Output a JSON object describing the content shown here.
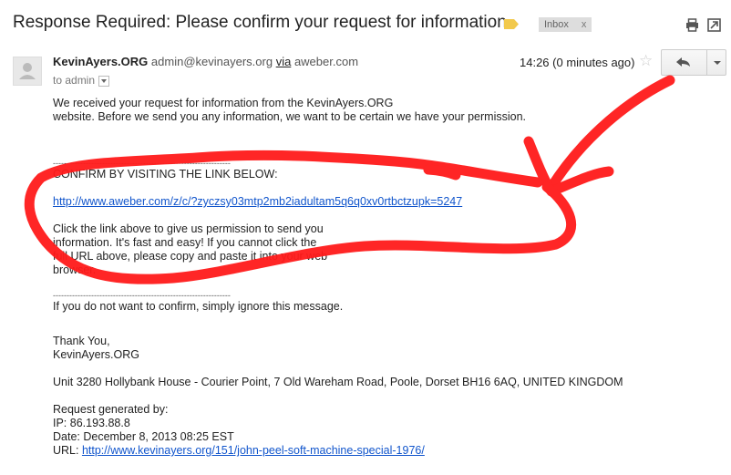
{
  "email": {
    "subject": "Response Required: Please confirm your request for information.",
    "label_chip": "Inbox",
    "label_chip_close": "x",
    "sender_name": "KevinAyers.ORG",
    "sender_email": "admin@kevinayers.org",
    "via_text": "via",
    "via_domain": "aweber.com",
    "to_line": "to admin",
    "time": "14:26 (0 minutes ago)"
  },
  "body": {
    "intro_line1": "We received your request for information from the KevinAyers.ORG",
    "intro_line2": "website.  Before we send you any information, we want to be certain we have your permission.",
    "divider1": "-----------------------------------------------------------------",
    "confirm_heading": "CONFIRM BY VISITING THE LINK BELOW:",
    "confirm_link": "http://www.aweber.com/z/c/?zyczsy03mtp2mb2iadultam5q6q0xv0rtbctzupk=5247",
    "instr_line1": "Click the link above to give us permission to send you",
    "instr_line2": "information.  It's fast and easy!  If you cannot click the",
    "instr_line3": "full URL above, please copy and paste it into your web",
    "instr_line4": "browser.",
    "divider2": "-----------------------------------------------------------------",
    "ignore_line": "If you do not want to confirm, simply ignore this message.",
    "thanks": "Thank You,",
    "signature": "KevinAyers.ORG",
    "address": "Unit 3280 Hollybank House - Courier Point, 7 Old Wareham Road, Poole, Dorset BH16 6AQ, UNITED KINGDOM",
    "request_heading": "Request generated by:",
    "ip_line": "IP: 86.193.88.8",
    "date_line": "Date: December 8, 2013 08:25 EST",
    "url_label": "URL: ",
    "url_link": "http://www.kevinayers.org/151/john-peel-soft-machine-special-1976/"
  },
  "icons": {
    "label_tag": "label-tag-icon",
    "print": "print-icon",
    "new_window": "new-window-icon",
    "avatar": "avatar-icon",
    "star": "star-icon",
    "reply": "reply-icon",
    "more": "chevron-down-icon"
  },
  "colors": {
    "label_tag": "#f2c94c",
    "link": "#1155cc",
    "scribble": "#ff1a1a"
  }
}
